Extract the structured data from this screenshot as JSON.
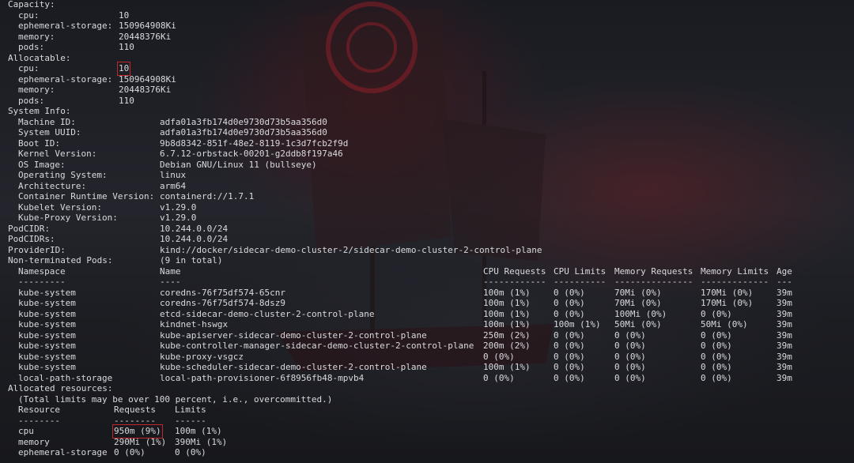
{
  "terminal": {
    "capacity": {
      "heading": "Capacity:",
      "rows": [
        {
          "key": "cpu:",
          "value": "10"
        },
        {
          "key": "ephemeral-storage:",
          "value": "150964908Ki"
        },
        {
          "key": "memory:",
          "value": "20448376Ki"
        },
        {
          "key": "pods:",
          "value": "110"
        }
      ]
    },
    "allocatable": {
      "heading": "Allocatable:",
      "rows": [
        {
          "key": "cpu:",
          "value": "10",
          "highlight": true
        },
        {
          "key": "ephemeral-storage:",
          "value": "150964908Ki"
        },
        {
          "key": "memory:",
          "value": "20448376Ki"
        },
        {
          "key": "pods:",
          "value": "110"
        }
      ]
    },
    "system_info": {
      "heading": "System Info:",
      "rows": [
        {
          "key": "Machine ID:",
          "value": "adfa01a3fb174d0e9730d73b5aa356d0"
        },
        {
          "key": "System UUID:",
          "value": "adfa01a3fb174d0e9730d73b5aa356d0"
        },
        {
          "key": "Boot ID:",
          "value": "9b8d8342-851f-48e2-8119-1c3d7fcb2f9d"
        },
        {
          "key": "Kernel Version:",
          "value": "6.7.12-orbstack-00201-g2ddb8f197a46"
        },
        {
          "key": "OS Image:",
          "value": "Debian GNU/Linux 11 (bullseye)"
        },
        {
          "key": "Operating System:",
          "value": "linux"
        },
        {
          "key": "Architecture:",
          "value": "arm64"
        },
        {
          "key": "Container Runtime Version:",
          "value": "containerd://1.7.1"
        },
        {
          "key": "Kubelet Version:",
          "value": "v1.29.0"
        },
        {
          "key": "Kube-Proxy Version:",
          "value": "v1.29.0"
        }
      ]
    },
    "top_fields": [
      {
        "key": "PodCIDR:",
        "value": "10.244.0.0/24"
      },
      {
        "key": "PodCIDRs:",
        "value": "10.244.0.0/24"
      },
      {
        "key": "ProviderID:",
        "value": "kind://docker/sidecar-demo-cluster-2/sidecar-demo-cluster-2-control-plane"
      },
      {
        "key": "Non-terminated Pods:",
        "value": "(9 in total)"
      }
    ],
    "pods": {
      "columns": [
        "Namespace",
        "Name",
        "CPU Requests",
        "CPU Limits",
        "Memory Requests",
        "Memory Limits",
        "Age"
      ],
      "dashes": [
        "---------",
        "----",
        "------------",
        "----------",
        "---------------",
        "-------------",
        "---"
      ],
      "rows": [
        [
          "kube-system",
          "coredns-76f75df574-65cnr",
          "100m (1%)",
          "0 (0%)",
          "70Mi (0%)",
          "170Mi (0%)",
          "39m"
        ],
        [
          "kube-system",
          "coredns-76f75df574-8dsz9",
          "100m (1%)",
          "0 (0%)",
          "70Mi (0%)",
          "170Mi (0%)",
          "39m"
        ],
        [
          "kube-system",
          "etcd-sidecar-demo-cluster-2-control-plane",
          "100m (1%)",
          "0 (0%)",
          "100Mi (0%)",
          "0 (0%)",
          "39m"
        ],
        [
          "kube-system",
          "kindnet-hswgx",
          "100m (1%)",
          "100m (1%)",
          "50Mi (0%)",
          "50Mi (0%)",
          "39m"
        ],
        [
          "kube-system",
          "kube-apiserver-sidecar-demo-cluster-2-control-plane",
          "250m (2%)",
          "0 (0%)",
          "0 (0%)",
          "0 (0%)",
          "39m"
        ],
        [
          "kube-system",
          "kube-controller-manager-sidecar-demo-cluster-2-control-plane",
          "200m (2%)",
          "0 (0%)",
          "0 (0%)",
          "0 (0%)",
          "39m"
        ],
        [
          "kube-system",
          "kube-proxy-vsgcz",
          "0 (0%)",
          "0 (0%)",
          "0 (0%)",
          "0 (0%)",
          "39m"
        ],
        [
          "kube-system",
          "kube-scheduler-sidecar-demo-cluster-2-control-plane",
          "100m (1%)",
          "0 (0%)",
          "0 (0%)",
          "0 (0%)",
          "39m"
        ],
        [
          "local-path-storage",
          "local-path-provisioner-6f8956fb48-mpvb4",
          "0 (0%)",
          "0 (0%)",
          "0 (0%)",
          "0 (0%)",
          "39m"
        ]
      ]
    },
    "allocated": {
      "heading": "Allocated resources:",
      "note": "(Total limits may be over 100 percent, i.e., overcommitted.)",
      "columns": [
        "Resource",
        "Requests",
        "Limits"
      ],
      "dashes": [
        "--------",
        "--------",
        "------"
      ],
      "rows": [
        {
          "cells": [
            "cpu",
            "950m (9%)",
            "100m (1%)"
          ],
          "highlight": true
        },
        {
          "cells": [
            "memory",
            "290Mi (1%)",
            "390Mi (1%)"
          ]
        },
        {
          "cells": [
            "ephemeral-storage",
            "0 (0%)",
            "0 (0%)"
          ]
        }
      ]
    },
    "highlight_color": "#c0272d"
  },
  "background": {
    "icon": "pirate-ship-wallpaper",
    "accent": "#8a1e26"
  }
}
